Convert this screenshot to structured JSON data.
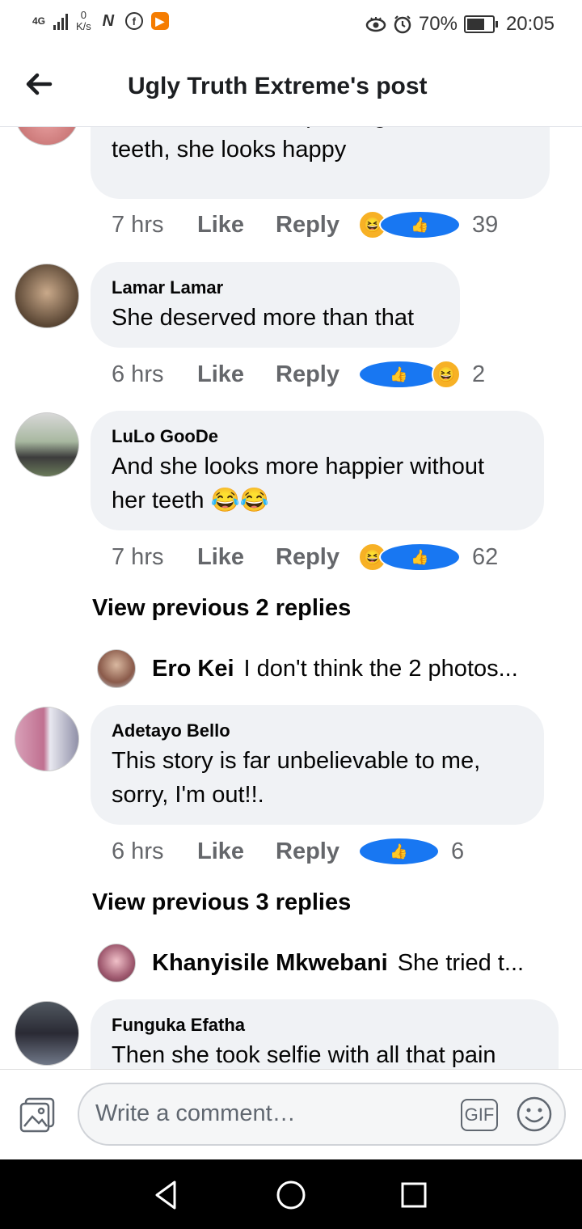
{
  "status_bar": {
    "network": "4G",
    "net_speed_value": "0",
    "net_speed_unit": "K/s",
    "battery_percent": "70%",
    "battery_level": 0.7,
    "time": "20:05"
  },
  "header": {
    "title": "Ugly Truth Extreme's post"
  },
  "comments": [
    {
      "text": "Well, she isn't complaining about the teeth, she looks happy",
      "time": "7 hrs",
      "like": "Like",
      "reply": "Reply",
      "count": "39"
    },
    {
      "name": "Lamar Lamar",
      "text": "She deserved more than that",
      "time": "6 hrs",
      "like": "Like",
      "reply": "Reply",
      "count": "2"
    },
    {
      "name": "LuLo GooDe",
      "text": "And she looks more happier without her teeth 😂😂",
      "time": "7 hrs",
      "like": "Like",
      "reply": "Reply",
      "count": "62"
    },
    {
      "name": "Adetayo Bello",
      "text": "This story is far unbelievable  to me, sorry, I'm  out!!.",
      "time": "6 hrs",
      "like": "Like",
      "reply": "Reply",
      "count": "6"
    },
    {
      "name": "Funguka Efatha",
      "text": "Then she took selfie with all that pain"
    }
  ],
  "view_previous": [
    "View previous 2 replies",
    "View previous 3 replies"
  ],
  "replies": [
    {
      "name": "Ero Kei",
      "text": "I don't think the 2 photos..."
    },
    {
      "name": "Khanyisile Mkwebani",
      "text": "She tried t..."
    }
  ],
  "composer": {
    "placeholder": "Write a comment…",
    "gif": "GIF"
  },
  "colors": {
    "accent": "#1877f2",
    "bubble": "#f0f2f5",
    "meta": "#65676b",
    "haha": "#f7b125"
  }
}
